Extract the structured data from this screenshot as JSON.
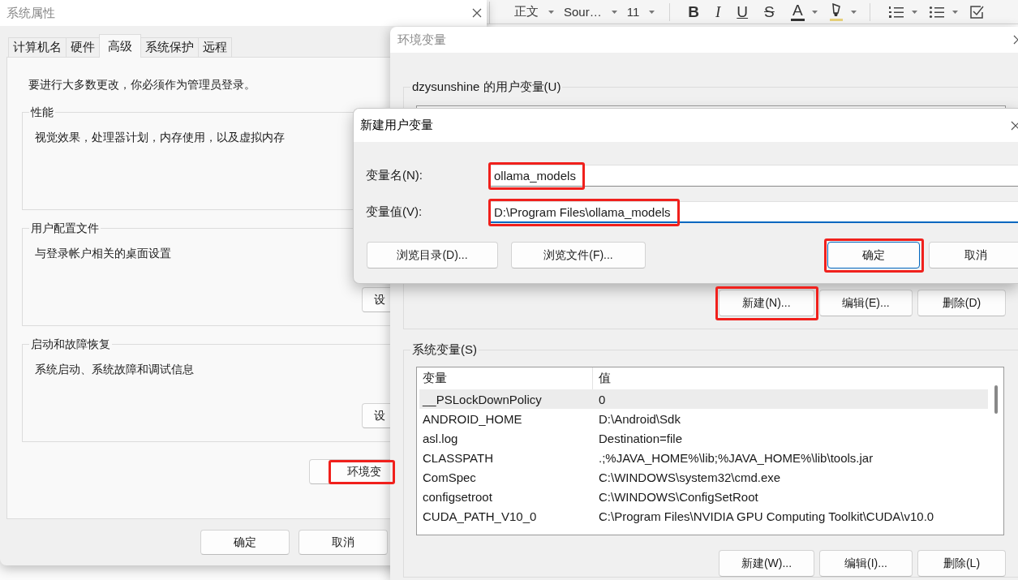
{
  "editor_toolbar": {
    "dropdowns": [
      {
        "label": "正文"
      },
      {
        "label": "Sour…"
      },
      {
        "label": "11"
      }
    ],
    "tools": [
      {
        "kind": "bold",
        "label": "B",
        "has_menu": false
      },
      {
        "kind": "italic",
        "label": "I",
        "has_menu": false
      },
      {
        "kind": "underline",
        "label": "U",
        "has_menu": false
      },
      {
        "kind": "strike",
        "label": "S",
        "has_menu": false
      },
      {
        "kind": "font_color",
        "label": "A",
        "has_menu": true
      },
      {
        "kind": "highlight",
        "has_menu": true
      },
      {
        "kind": "numbered_list",
        "has_menu": true
      },
      {
        "kind": "bullet_list",
        "has_menu": true
      },
      {
        "kind": "checklist",
        "has_menu": false
      }
    ]
  },
  "system_properties": {
    "title": "系统属性",
    "active": false,
    "tabs": [
      {
        "label": "计算机名",
        "selected": false
      },
      {
        "label": "硬件",
        "selected": false
      },
      {
        "label": "高级",
        "selected": true
      },
      {
        "label": "系统保护",
        "selected": false
      },
      {
        "label": "远程",
        "selected": false
      }
    ],
    "notice": "要进行大多数更改，你必须作为管理员登录。",
    "groups": [
      {
        "title": "性能",
        "text": "视觉效果，处理器计划，内存使用，以及虚拟内存"
      },
      {
        "title": "用户配置文件",
        "text": "与登录帐户相关的桌面设置",
        "button": "设"
      },
      {
        "title": "启动和故障恢复",
        "text": "系统启动、系统故障和调试信息",
        "button": "设"
      }
    ],
    "env_button": {
      "label": "环境变",
      "highlighted": true
    },
    "buttons": [
      {
        "label": "确定",
        "highlighted": false
      },
      {
        "label": "取消",
        "highlighted": false
      }
    ]
  },
  "environment_variables": {
    "title": "环境变量",
    "active": false,
    "user_variables": {
      "title": "dzysunshine 的用户变量(U)",
      "buttons": [
        {
          "label": "新建(N)...",
          "highlighted": true
        },
        {
          "label": "编辑(E)...",
          "highlighted": false
        },
        {
          "label": "删除(D)",
          "highlighted": false
        }
      ]
    },
    "system_variables": {
      "title": "系统变量(S)",
      "columns": [
        "变量",
        "值"
      ],
      "rows": [
        {
          "name": "__PSLockDownPolicy",
          "value": "0",
          "selected": true
        },
        {
          "name": "ANDROID_HOME",
          "value": "D:\\Android\\Sdk",
          "selected": false
        },
        {
          "name": "asl.log",
          "value": "Destination=file",
          "selected": false
        },
        {
          "name": "CLASSPATH",
          "value": ".;%JAVA_HOME%\\lib;%JAVA_HOME%\\lib\\tools.jar",
          "selected": false
        },
        {
          "name": "ComSpec",
          "value": "C:\\WINDOWS\\system32\\cmd.exe",
          "selected": false
        },
        {
          "name": "configsetroot",
          "value": "C:\\WINDOWS\\ConfigSetRoot",
          "selected": false
        },
        {
          "name": "CUDA_PATH_V10_0",
          "value": "C:\\Program Files\\NVIDIA GPU Computing Toolkit\\CUDA\\v10.0",
          "selected": false
        }
      ],
      "buttons": [
        {
          "label": "新建(W)...",
          "highlighted": false
        },
        {
          "label": "编辑(I)...",
          "highlighted": false
        },
        {
          "label": "删除(L)",
          "highlighted": false
        }
      ]
    }
  },
  "new_user_variable": {
    "title": "新建用户变量",
    "active": true,
    "fields": [
      {
        "label": "变量名(N):",
        "value": "ollama_models",
        "focused": false,
        "highlighted": true
      },
      {
        "label": "变量值(V):",
        "value": "D:\\Program Files\\ollama_models",
        "focused": true,
        "highlighted": true
      }
    ],
    "buttons": [
      {
        "label": "浏览目录(D)...",
        "default": false,
        "highlighted": false
      },
      {
        "label": "浏览文件(F)...",
        "default": false,
        "highlighted": false
      },
      {
        "label": "确定",
        "default": true,
        "highlighted": true
      },
      {
        "label": "取消",
        "default": false,
        "highlighted": false
      }
    ]
  }
}
